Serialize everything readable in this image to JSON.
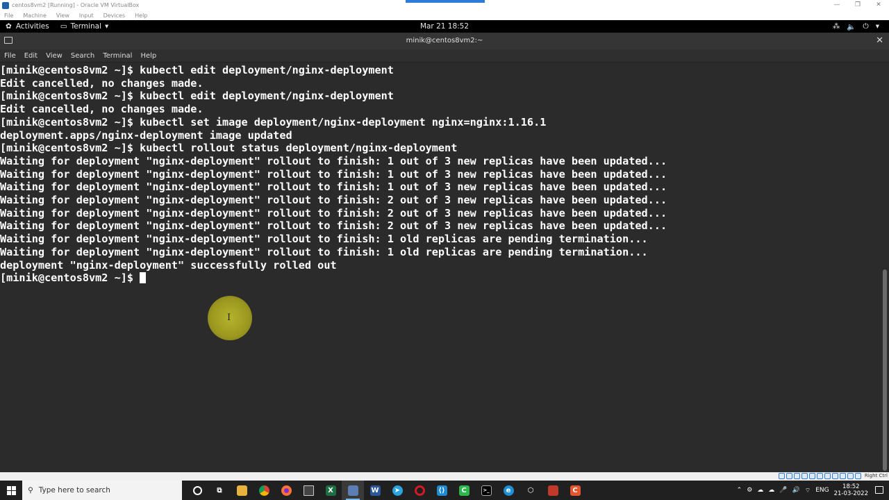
{
  "vbox": {
    "title": "centos8vm2 [Running] - Oracle VM VirtualBox",
    "menu": [
      "File",
      "Machine",
      "View",
      "Input",
      "Devices",
      "Help"
    ],
    "status_right": "Right Ctrl"
  },
  "gnome": {
    "activities": "Activities",
    "app_menu": "Terminal",
    "clock": "Mar 21  18:52"
  },
  "terminal": {
    "window_title": "minik@centos8vm2:~",
    "menu": [
      "File",
      "Edit",
      "View",
      "Search",
      "Terminal",
      "Help"
    ],
    "lines": [
      "[minik@centos8vm2 ~]$ kubectl edit deployment/nginx-deployment",
      "Edit cancelled, no changes made.",
      "[minik@centos8vm2 ~]$ kubectl edit deployment/nginx-deployment",
      "Edit cancelled, no changes made.",
      "[minik@centos8vm2 ~]$ kubectl set image deployment/nginx-deployment nginx=nginx:1.16.1",
      "deployment.apps/nginx-deployment image updated",
      "[minik@centos8vm2 ~]$ kubectl rollout status deployment/nginx-deployment",
      "Waiting for deployment \"nginx-deployment\" rollout to finish: 1 out of 3 new replicas have been updated...",
      "Waiting for deployment \"nginx-deployment\" rollout to finish: 1 out of 3 new replicas have been updated...",
      "Waiting for deployment \"nginx-deployment\" rollout to finish: 1 out of 3 new replicas have been updated...",
      "Waiting for deployment \"nginx-deployment\" rollout to finish: 2 out of 3 new replicas have been updated...",
      "Waiting for deployment \"nginx-deployment\" rollout to finish: 2 out of 3 new replicas have been updated...",
      "Waiting for deployment \"nginx-deployment\" rollout to finish: 2 out of 3 new replicas have been updated...",
      "Waiting for deployment \"nginx-deployment\" rollout to finish: 1 old replicas are pending termination...",
      "Waiting for deployment \"nginx-deployment\" rollout to finish: 1 old replicas are pending termination...",
      "deployment \"nginx-deployment\" successfully rolled out"
    ],
    "prompt": "[minik@centos8vm2 ~]$ "
  },
  "taskbar": {
    "search_placeholder": "Type here to search",
    "language": "ENG",
    "time": "18:52",
    "date": "21-03-2022"
  },
  "colors": {
    "terminal_bg": "#2b2b2b",
    "terminal_fg": "#ffffff",
    "taskbar_bg": "#202020",
    "highlight": "#c6c22c"
  }
}
